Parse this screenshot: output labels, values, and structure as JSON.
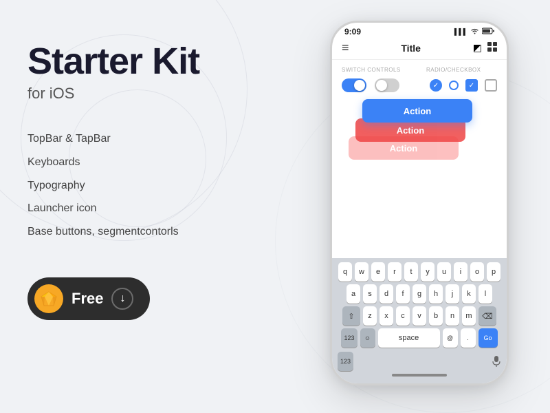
{
  "background": {
    "color": "#eef0f5"
  },
  "left_panel": {
    "title_line1": "Starter Kit",
    "title_line2": "for iOS",
    "features": [
      "TopBar & TapBar",
      "Keyboards",
      "Typography",
      "Launcher icon",
      "Base buttons, segmentcontorls"
    ],
    "badge": {
      "label": "Free",
      "icon": "sketch-icon",
      "download_icon": "↓"
    }
  },
  "phone": {
    "status_bar": {
      "time": "9:09",
      "signal": "▌▌▌",
      "wifi": "WiFi",
      "battery": "🔋"
    },
    "nav": {
      "left_icon": "≡",
      "title": "Title",
      "right_icon1": "◩",
      "right_icon2": "⊞"
    },
    "controls": {
      "switch_label": "SWITCH CONTROLS",
      "radio_label": "RADIO/CHECKBOX"
    },
    "buttons": [
      {
        "label": "Action",
        "color": "blue",
        "z": 3
      },
      {
        "label": "Action",
        "color": "red",
        "z": 2
      },
      {
        "label": "Action",
        "color": "pink",
        "z": 1
      }
    ],
    "keyboard": {
      "rows": [
        [
          "q",
          "w",
          "e",
          "r",
          "t",
          "y",
          "u",
          "i",
          "o",
          "p"
        ],
        [
          "a",
          "s",
          "d",
          "f",
          "g",
          "h",
          "j",
          "k",
          "l"
        ],
        [
          "z",
          "x",
          "c",
          "v",
          "b",
          "n",
          "m"
        ],
        [
          "123",
          "space",
          "@",
          ".",
          "Go"
        ]
      ]
    }
  }
}
